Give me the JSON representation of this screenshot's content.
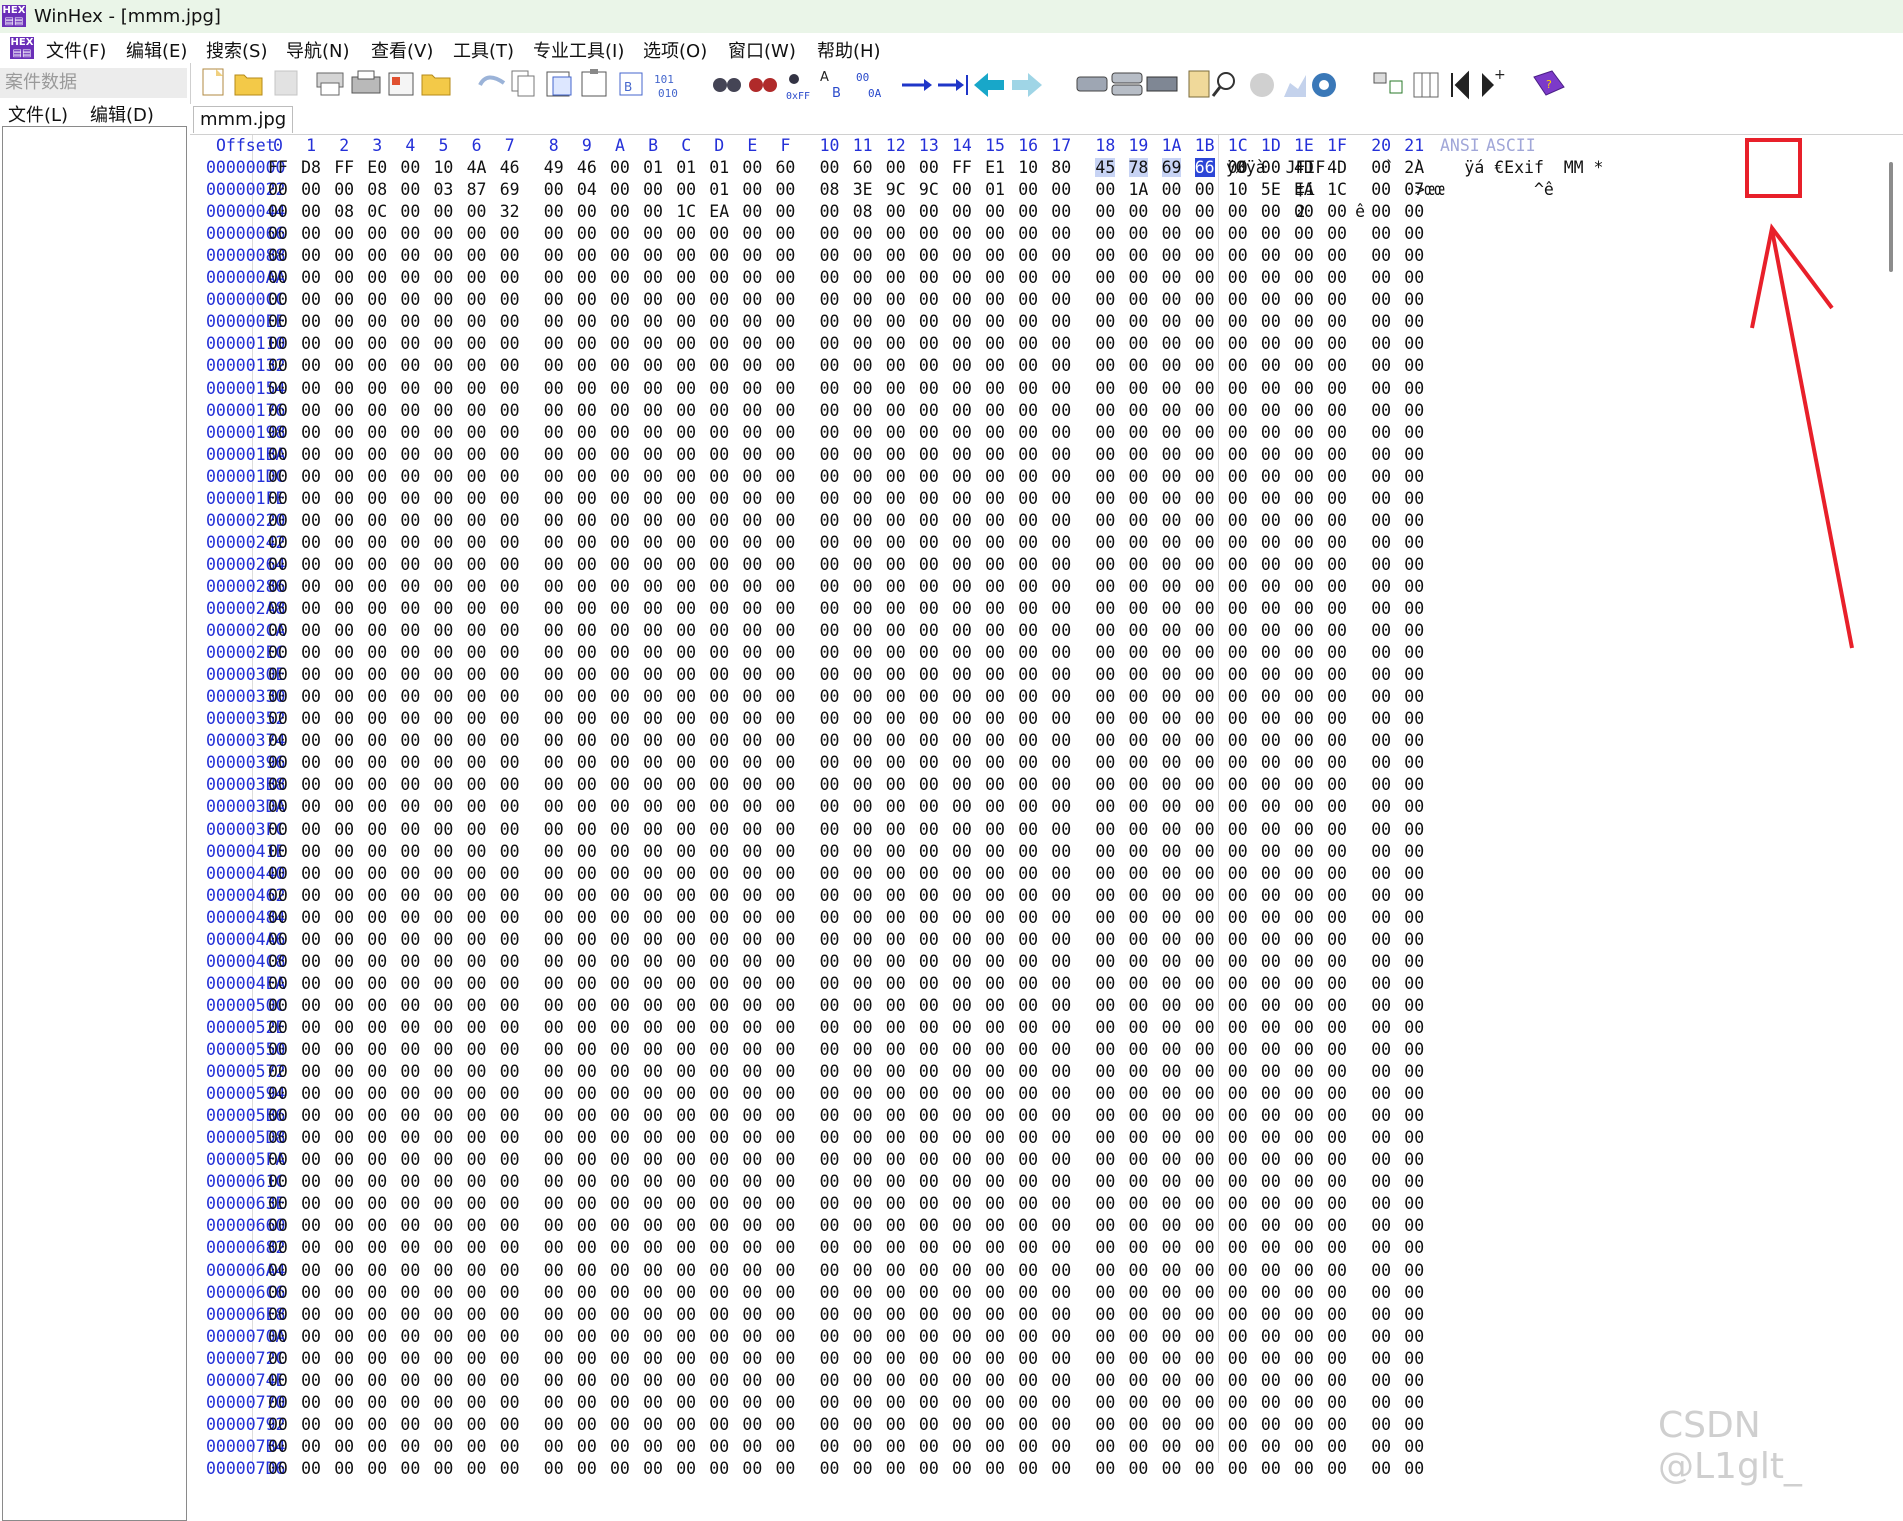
{
  "window": {
    "title": "WinHex - [mmm.jpg]",
    "icon": "hex-app-icon"
  },
  "menu": {
    "items": [
      "文件(F)",
      "编辑(E)",
      "搜索(S)",
      "导航(N)",
      "查看(V)",
      "工具(T)",
      "专业工具(I)",
      "选项(O)",
      "窗口(W)",
      "帮助(H)"
    ]
  },
  "left_panel": {
    "title": "案件数据",
    "menu": [
      "文件(L)",
      "编辑(D)"
    ]
  },
  "toolbar": {
    "icons": [
      "new-file-icon",
      "open-folder-icon",
      "save-icon",
      "print-icon",
      "printer-icon",
      "properties-icon",
      "open-dir-icon",
      "undo-icon",
      "copy-icon",
      "paste-icon",
      "clipboard-icon",
      "copy-block-icon",
      "write-icon",
      "find-icon",
      "find-hex-icon",
      "find-text-icon",
      "replace-icon",
      "replace-hex-icon",
      "goto-offset-icon",
      "goto-end-icon",
      "back-icon",
      "forward-icon",
      "disk-icon",
      "disk-clone-icon",
      "ram-icon",
      "calculator-icon",
      "search-icon",
      "globe-icon",
      "chart-icon",
      "gear-icon",
      "hex-ascii-icon",
      "columns-icon",
      "prev-icon",
      "next-icon",
      "help-book-icon"
    ]
  },
  "tab": {
    "label": "mmm.jpg"
  },
  "hex": {
    "offset_header": "Offset",
    "columns": [
      "0",
      "1",
      "2",
      "3",
      "4",
      "5",
      "6",
      "7",
      "8",
      "9",
      "A",
      "B",
      "C",
      "D",
      "E",
      "F",
      "10",
      "11",
      "12",
      "13",
      "14",
      "15",
      "16",
      "17",
      "18",
      "19",
      "1A",
      "1B",
      "1C",
      "1D",
      "1E",
      "1F",
      "20",
      "21"
    ],
    "ansi_header": "ANSI",
    "ascii_header": "ASCII",
    "rows": [
      {
        "offset": "00000000",
        "bytes": [
          "FF",
          "D8",
          "FF",
          "E0",
          "00",
          "10",
          "4A",
          "46",
          "49",
          "46",
          "00",
          "01",
          "01",
          "01",
          "00",
          "60",
          "00",
          "60",
          "00",
          "00",
          "FF",
          "E1",
          "10",
          "80",
          "45",
          "78",
          "69",
          "66",
          "00",
          "00",
          "4D",
          "4D",
          "00",
          "2A"
        ],
        "text": "ÿØÿà  JFIF      `  `    ÿá €Exif  MM *"
      },
      {
        "offset": "00000022",
        "bytes": [
          "00",
          "00",
          "00",
          "08",
          "00",
          "03",
          "87",
          "69",
          "00",
          "04",
          "00",
          "00",
          "00",
          "01",
          "00",
          "00",
          "08",
          "3E",
          "9C",
          "9C",
          "00",
          "01",
          "00",
          "00",
          "00",
          "1A",
          "00",
          "00",
          "10",
          "5E",
          "EA",
          "1C",
          "00",
          "07"
        ],
        "text": "       ‡i          >œœ         ^ê"
      },
      {
        "offset": "00000044",
        "bytes": [
          "00",
          "00",
          "08",
          "0C",
          "00",
          "00",
          "00",
          "32",
          "00",
          "00",
          "00",
          "00",
          "1C",
          "EA",
          "00",
          "00",
          "00",
          "08",
          "00",
          "00",
          "00",
          "00",
          "00",
          "00",
          "00",
          "00",
          "00",
          "00",
          "00",
          "00",
          "00",
          "00",
          "00",
          "00"
        ],
        "text": "       2     ê"
      },
      {
        "offset": "00000066"
      },
      {
        "offset": "00000088"
      },
      {
        "offset": "000000AA"
      },
      {
        "offset": "000000CC"
      },
      {
        "offset": "000000EE"
      },
      {
        "offset": "00000110"
      },
      {
        "offset": "00000132"
      },
      {
        "offset": "00000154"
      },
      {
        "offset": "00000176"
      },
      {
        "offset": "00000198"
      },
      {
        "offset": "000001BA"
      },
      {
        "offset": "000001DC"
      },
      {
        "offset": "000001FE"
      },
      {
        "offset": "00000220"
      },
      {
        "offset": "00000242"
      },
      {
        "offset": "00000264"
      },
      {
        "offset": "00000286"
      },
      {
        "offset": "000002A8"
      },
      {
        "offset": "000002CA"
      },
      {
        "offset": "000002EC"
      },
      {
        "offset": "0000030E"
      },
      {
        "offset": "00000330"
      },
      {
        "offset": "00000352"
      },
      {
        "offset": "00000374"
      },
      {
        "offset": "00000396"
      },
      {
        "offset": "000003B8"
      },
      {
        "offset": "000003DA"
      },
      {
        "offset": "000003FC"
      },
      {
        "offset": "0000041E"
      },
      {
        "offset": "00000440"
      },
      {
        "offset": "00000462"
      },
      {
        "offset": "00000484"
      },
      {
        "offset": "000004A6"
      },
      {
        "offset": "000004C8"
      },
      {
        "offset": "000004EA"
      },
      {
        "offset": "0000050C"
      },
      {
        "offset": "0000052E"
      },
      {
        "offset": "00000550"
      },
      {
        "offset": "00000572"
      },
      {
        "offset": "00000594"
      },
      {
        "offset": "000005B6"
      },
      {
        "offset": "000005D8"
      },
      {
        "offset": "000005FA"
      },
      {
        "offset": "0000061C"
      },
      {
        "offset": "0000063E"
      },
      {
        "offset": "00000660"
      },
      {
        "offset": "00000682"
      },
      {
        "offset": "000006A4"
      },
      {
        "offset": "000006C6"
      },
      {
        "offset": "000006E8"
      },
      {
        "offset": "0000070A"
      },
      {
        "offset": "0000072C"
      },
      {
        "offset": "0000074E"
      },
      {
        "offset": "00000770"
      },
      {
        "offset": "00000792"
      },
      {
        "offset": "000007B4"
      },
      {
        "offset": "000007D6"
      }
    ],
    "selected_bytes": {
      "row": 0,
      "from": 24,
      "to": 27,
      "cursor": 27
    }
  },
  "annotation": {
    "color": "#e8202a",
    "highlight_text": "Exif"
  },
  "watermark": "CSDN @L1glt_"
}
